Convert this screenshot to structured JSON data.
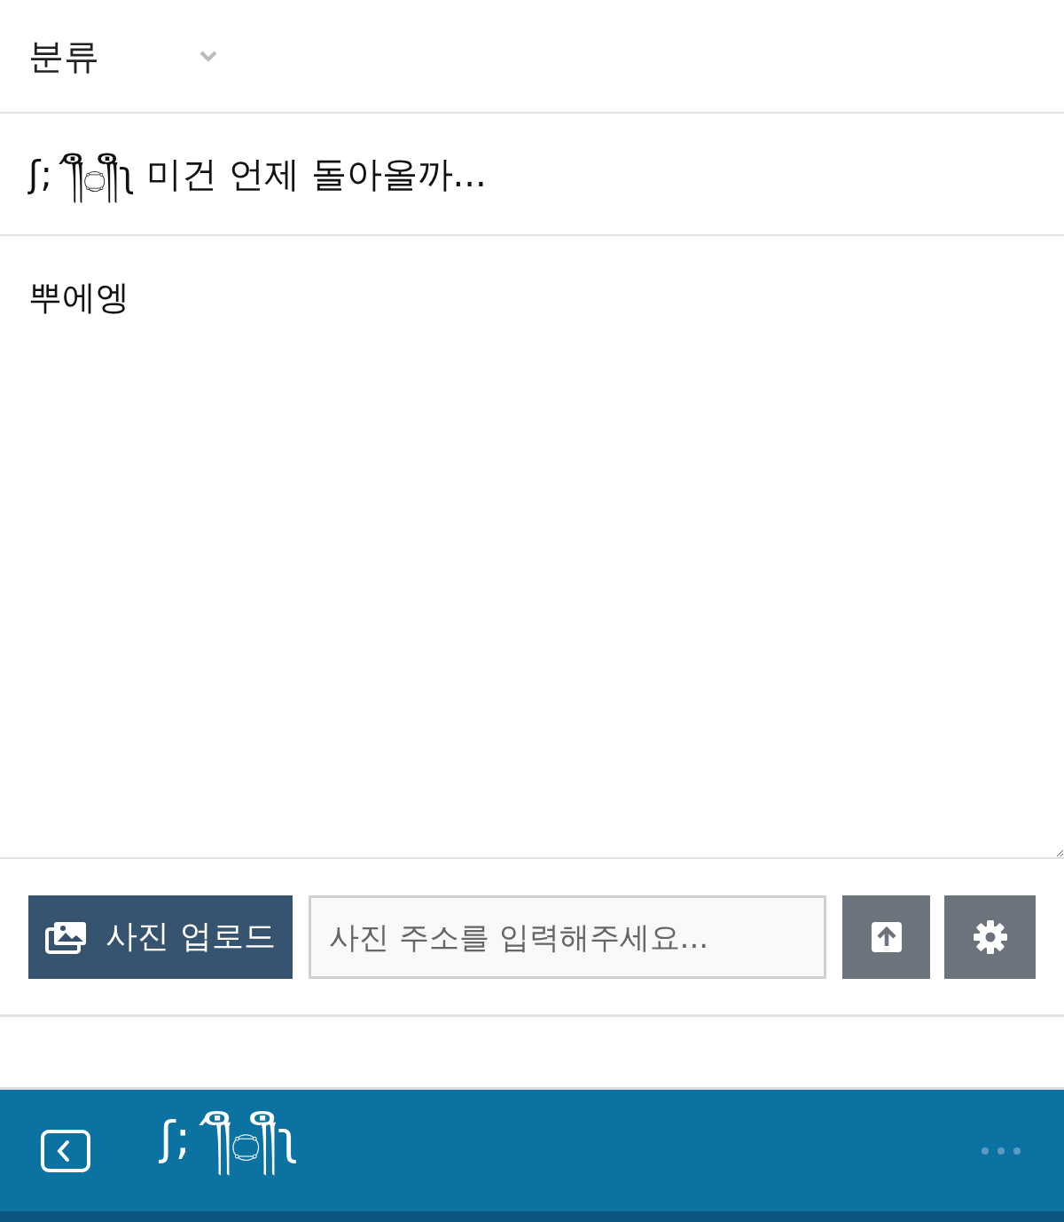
{
  "category": {
    "label": "분류"
  },
  "title_field": {
    "value": "ʃ;´༎ຶ۝༎ຶʅ 미건 언제 돌아올까..."
  },
  "body_field": {
    "value": "뿌에엥"
  },
  "toolbar": {
    "upload_button": "사진 업로드",
    "url_field": {
      "placeholder": "사진 주소를 입력해주세요..."
    }
  },
  "bottom_bar": {
    "title": "ʃ;´༎ຶ۝༎ຶʅ"
  }
}
